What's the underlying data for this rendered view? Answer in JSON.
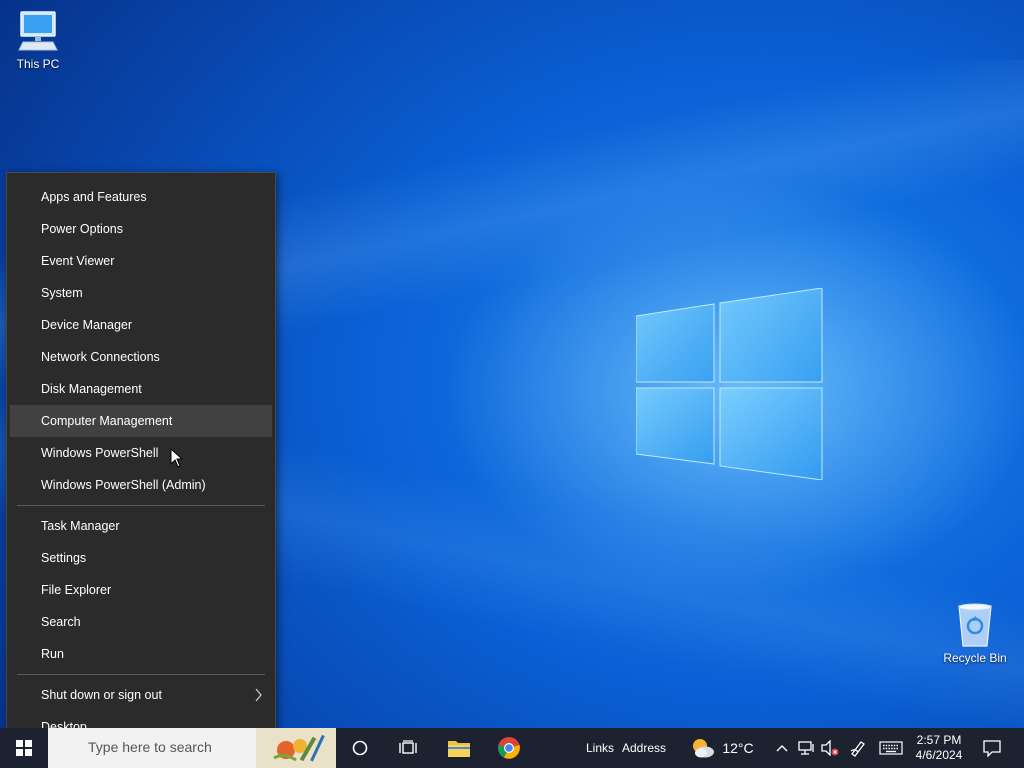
{
  "desktop": {
    "icons": [
      {
        "label": "This PC"
      },
      {
        "label": "Recycle Bin"
      }
    ]
  },
  "context_menu": {
    "items_group1": [
      "Apps and Features",
      "Power Options",
      "Event Viewer",
      "System",
      "Device Manager",
      "Network Connections",
      "Disk Management",
      "Computer Management",
      "Windows PowerShell",
      "Windows PowerShell (Admin)"
    ],
    "items_group2": [
      "Task Manager",
      "Settings",
      "File Explorer",
      "Search",
      "Run"
    ],
    "items_group3": [
      "Shut down or sign out",
      "Desktop"
    ],
    "highlighted_item": "Computer Management"
  },
  "taskbar": {
    "search_placeholder": "Type here to search",
    "toolbars": {
      "links": "Links",
      "address": "Address"
    },
    "weather": {
      "temperature": "12°C"
    },
    "clock": {
      "time": "2:57 PM",
      "date": "4/6/2024"
    }
  },
  "colors": {
    "menu_bg": "#2b2b2b",
    "menu_hover": "#414141",
    "taskbar_bg": "#1c2230",
    "desktop_accent": "#0a5fd4"
  }
}
